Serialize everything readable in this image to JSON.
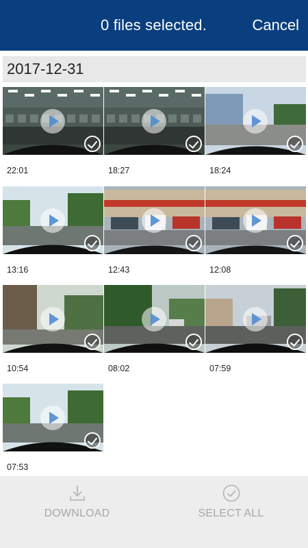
{
  "header": {
    "title": "0 files selected.",
    "cancel_label": "Cancel",
    "background": "#0a3f7f"
  },
  "date_group": "2017-12-31",
  "videos": [
    {
      "time": "22:01",
      "scene": "garage",
      "selected": false
    },
    {
      "time": "18:27",
      "scene": "garage",
      "selected": false
    },
    {
      "time": "18:24",
      "scene": "road-blue",
      "selected": false
    },
    {
      "time": "13:16",
      "scene": "road-green",
      "selected": false
    },
    {
      "time": "12:43",
      "scene": "shops",
      "selected": false
    },
    {
      "time": "12:08",
      "scene": "shops",
      "selected": false
    },
    {
      "time": "10:54",
      "scene": "alley",
      "selected": false
    },
    {
      "time": "08:02",
      "scene": "trees",
      "selected": false
    },
    {
      "time": "07:59",
      "scene": "houses",
      "selected": false
    },
    {
      "time": "07:53",
      "scene": "road-green",
      "selected": false
    }
  ],
  "bottom_bar": {
    "download_label": "DOWNLOAD",
    "select_all_label": "SELECT ALL",
    "download_icon": "download-icon",
    "select_all_icon": "check-circle-icon"
  }
}
